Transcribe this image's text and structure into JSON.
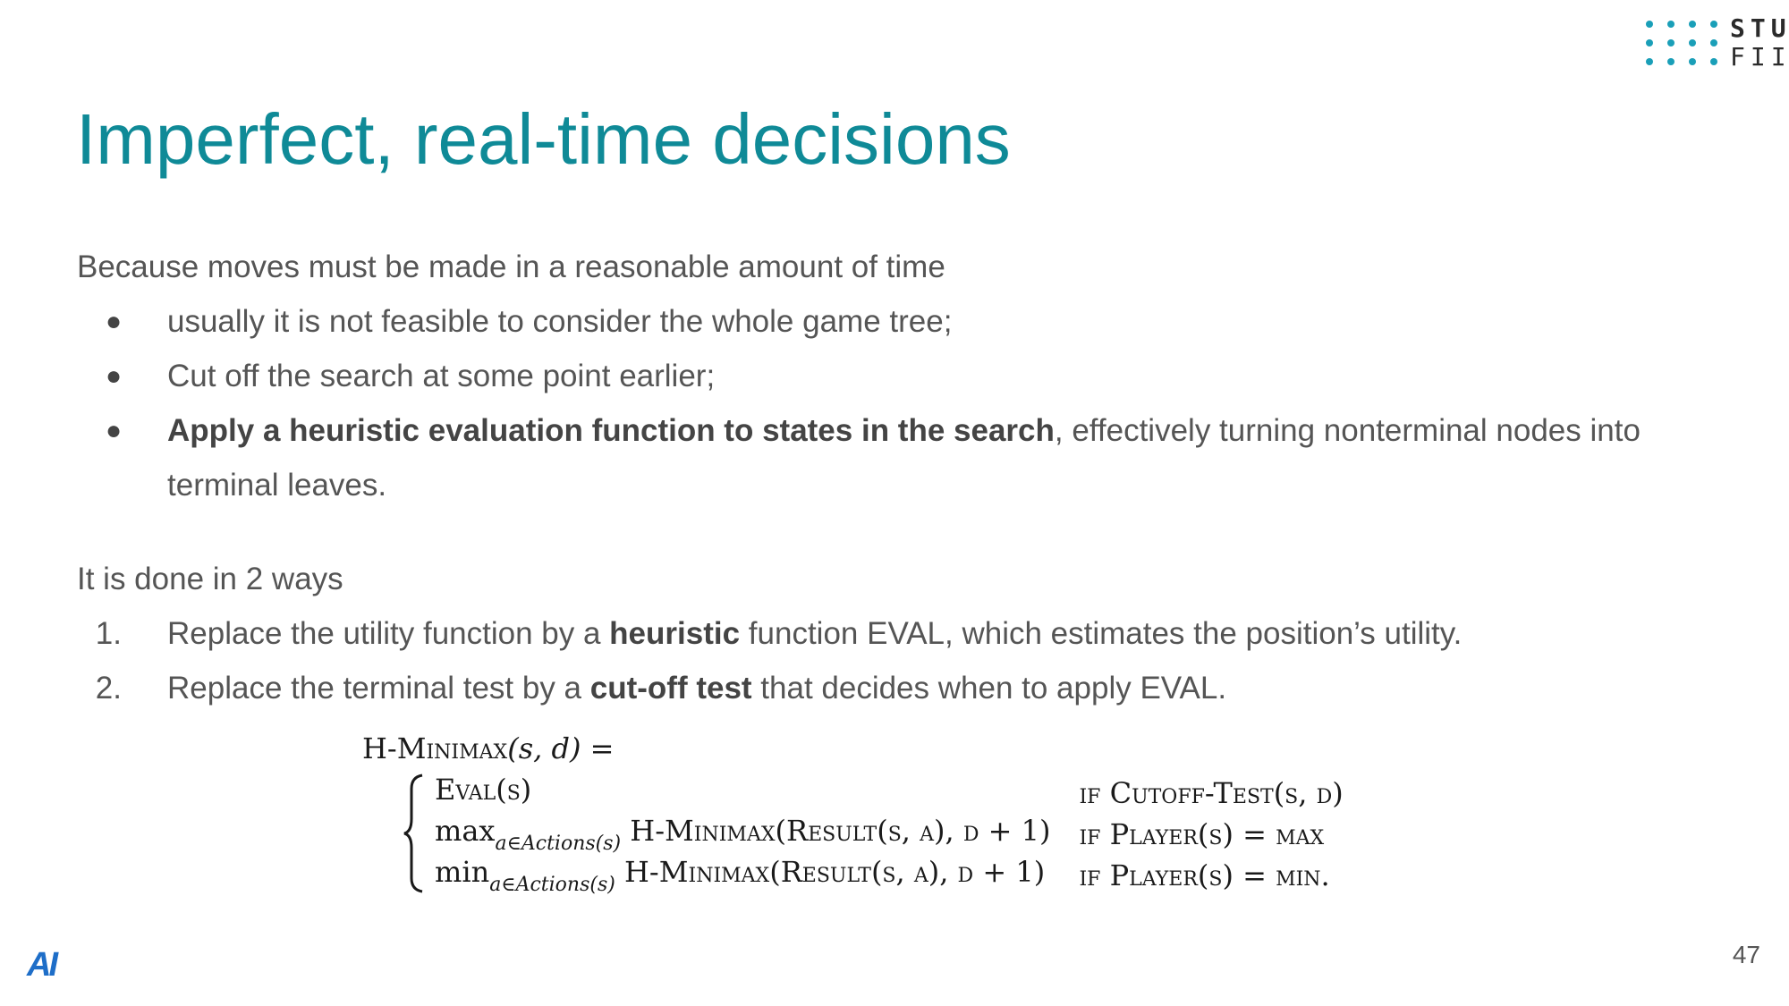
{
  "logo": {
    "line1": "STU",
    "line2": "FIIT",
    "dot_color": "#1a9fb8"
  },
  "title": "Imperfect, real-time decisions",
  "intro": "Because moves must be made in a reasonable amount of time",
  "bullets": [
    {
      "text": "usually it is not feasible to consider the whole game tree;"
    },
    {
      "text": "Cut off the search at some point earlier;"
    },
    {
      "bold": "Apply a heuristic evaluation function to states in the search",
      "text": ", effectively turning nonterminal nodes into terminal leaves."
    }
  ],
  "ways_intro": "It is done in 2 ways",
  "ways": [
    {
      "num": "1.",
      "pre": "Replace the utility function by a ",
      "bold": "heuristic",
      "post": " function EVAL, which estimates the position’s utility."
    },
    {
      "num": "2.",
      "pre": "Replace the terminal test by a ",
      "bold": "cut-off test",
      "post": " that decides when to apply EVAL."
    }
  ],
  "formula": {
    "head_fn": "H-Minimax",
    "head_args": "(s, d) =",
    "rows": [
      {
        "expr": {
          "op": "",
          "sub": "",
          "body": "Eval(s)"
        },
        "cond": "if Cutoff-Test(s, d)"
      },
      {
        "expr": {
          "op": "max",
          "sub": "a∈Actions(s)",
          "body": " H-Minimax(Result(s, a), d + 1)"
        },
        "cond": "if Player(s) = max"
      },
      {
        "expr": {
          "op": "min",
          "sub": "a∈Actions(s)",
          "body": " H-Minimax(Result(s, a), d + 1)"
        },
        "cond": "if Player(s) = min."
      }
    ]
  },
  "footer": {
    "ai_logo": "AI",
    "page_number": "47"
  },
  "colors": {
    "title": "#0f8a97",
    "body_text": "#555555",
    "ai_logo": "#1e6ec8"
  }
}
